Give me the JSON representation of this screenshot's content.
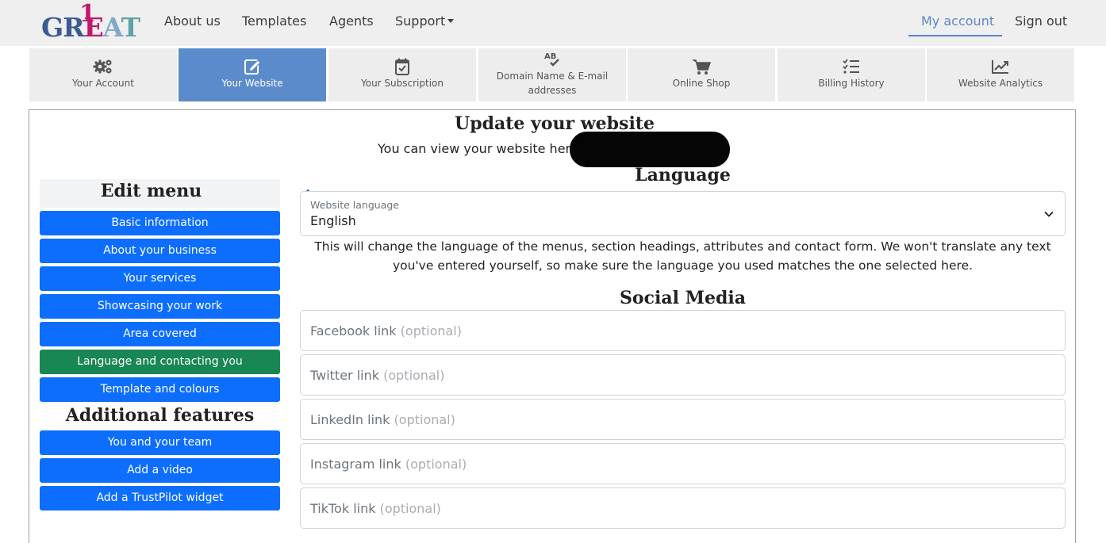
{
  "brand": {
    "logo_text": "GREAT",
    "logo_numeral": "1"
  },
  "nav": {
    "items": [
      {
        "label": "About us"
      },
      {
        "label": "Templates"
      },
      {
        "label": "Agents"
      },
      {
        "label": "Support"
      }
    ],
    "account_label": "My account",
    "signout_label": "Sign out"
  },
  "tabs": [
    {
      "label": "Your Account",
      "icon": "gears-icon"
    },
    {
      "label": "Your Website",
      "icon": "edit-icon",
      "active": true
    },
    {
      "label": "Your Subscription",
      "icon": "calendar-check-icon"
    },
    {
      "label": "Domain Name & E-mail addresses",
      "icon": "spell-check-icon"
    },
    {
      "label": "Online Shop",
      "icon": "cart-icon"
    },
    {
      "label": "Billing History",
      "icon": "list-check-icon"
    },
    {
      "label": "Website Analytics",
      "icon": "chart-line-icon"
    }
  ],
  "page": {
    "title": "Update your website",
    "view_text": "You can view your website here:"
  },
  "edit_menu": {
    "title": "Edit menu",
    "items": [
      {
        "label": "Basic information"
      },
      {
        "label": "About your business"
      },
      {
        "label": "Your services"
      },
      {
        "label": "Showcasing your work"
      },
      {
        "label": "Area covered"
      },
      {
        "label": "Language and contacting you",
        "active": true
      },
      {
        "label": "Template and colours"
      }
    ],
    "additional_title": "Additional features",
    "additional_items": [
      {
        "label": "You and your team"
      },
      {
        "label": "Add a video"
      },
      {
        "label": "Add a TrustPilot widget"
      }
    ]
  },
  "language": {
    "section_title": "Language",
    "field_label": "Website language",
    "selected": "English",
    "note": "This will change the language of the menus, section headings, attributes and contact form. We won't translate any text you've entered yourself, so make sure the language you used matches the one selected here."
  },
  "social": {
    "section_title": "Social Media",
    "optional_suffix": "(optional)",
    "fields": [
      {
        "label": "Facebook link"
      },
      {
        "label": "Twitter link"
      },
      {
        "label": "LinkedIn link"
      },
      {
        "label": "Instagram link"
      },
      {
        "label": "TikTok link"
      }
    ]
  },
  "colors": {
    "primary_button": "#0d6efd",
    "active_menu": "#198754",
    "active_tab": "#5b8bcb",
    "nav_accent": "#5b87c9"
  }
}
